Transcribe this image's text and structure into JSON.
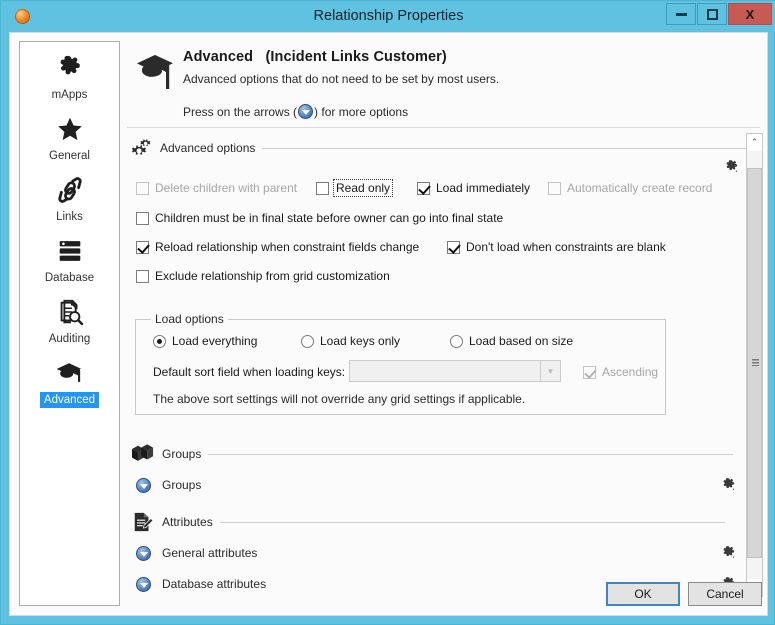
{
  "window": {
    "title": "Relationship Properties",
    "app_icon": "orb-icon",
    "controls": {
      "minimize": "minimize-button",
      "maximize": "maximize-button",
      "close_label": "X"
    },
    "titlebar_color": "#5ec2e0",
    "close_button_color": "#c75b54"
  },
  "sidebar": {
    "items": [
      {
        "label": "mApps",
        "icon": "puzzle-piece-icon",
        "selected": false
      },
      {
        "label": "General",
        "icon": "star-icon",
        "selected": false
      },
      {
        "label": "Links",
        "icon": "chain-link-icon",
        "selected": false
      },
      {
        "label": "Database",
        "icon": "database-icon",
        "selected": false
      },
      {
        "label": "Auditing",
        "icon": "document-search-icon",
        "selected": false
      },
      {
        "label": "Advanced",
        "icon": "graduation-cap-icon",
        "selected": true
      }
    ],
    "selected_highlight_color": "#2196f3"
  },
  "header": {
    "icon": "graduation-cap-icon",
    "title": "Advanced",
    "subject": "(Incident Links Customer)",
    "description": "Advanced options that do not need to be set by most users.",
    "hint_before": "Press on the arrows (",
    "hint_after": ") for more options"
  },
  "sections": {
    "advanced_options": {
      "icon": "gears-icon",
      "label": "Advanced options",
      "checkboxes": [
        {
          "label": "Delete children with parent",
          "checked": false,
          "disabled": true,
          "focused": false
        },
        {
          "label": "Read only",
          "checked": false,
          "disabled": false,
          "focused": true
        },
        {
          "label": "Load immediately",
          "checked": true,
          "disabled": false,
          "focused": false
        },
        {
          "label": "Automatically create record",
          "checked": false,
          "disabled": true,
          "focused": false
        },
        {
          "label": "Children must be in final state before owner can go into final state",
          "checked": false,
          "disabled": false,
          "focused": false
        },
        {
          "label": "Reload relationship when constraint fields change",
          "checked": true,
          "disabled": false,
          "focused": false
        },
        {
          "label": "Don't load when constraints are blank",
          "checked": true,
          "disabled": false,
          "focused": false
        },
        {
          "label": "Exclude relationship from grid customization",
          "checked": false,
          "disabled": false,
          "focused": false
        }
      ],
      "load_options": {
        "group_label": "Load options",
        "radios": [
          {
            "label": "Load everything",
            "selected": true
          },
          {
            "label": "Load keys only",
            "selected": false
          },
          {
            "label": "Load based on size",
            "selected": false
          }
        ],
        "sort_field_label": "Default sort field when loading keys:",
        "sort_field_value": "",
        "sort_field_disabled": true,
        "ascending": {
          "label": "Ascending",
          "checked": true,
          "disabled": true
        },
        "note": "The above sort settings will not override any grid settings if applicable."
      }
    },
    "groups": {
      "icon": "boxes-icon",
      "label": "Groups",
      "rows": [
        {
          "label": "Groups",
          "expander": "collapsed-arrow-icon",
          "action": "puzzle-piece-icon"
        }
      ]
    },
    "attributes": {
      "icon": "document-edit-icon",
      "label": "Attributes",
      "rows": [
        {
          "label": "General attributes",
          "expander": "collapsed-arrow-icon",
          "action": "puzzle-piece-icon"
        },
        {
          "label": "Database attributes",
          "expander": "collapsed-arrow-icon",
          "action": "puzzle-piece-icon"
        }
      ]
    }
  },
  "scrollbar": {
    "up_glyph": "⌃",
    "down_glyph": "⌄",
    "grip": "scrollbar-grip"
  },
  "footer": {
    "ok_label": "OK",
    "cancel_label": "Cancel",
    "focus_color": "#3f86c6"
  }
}
